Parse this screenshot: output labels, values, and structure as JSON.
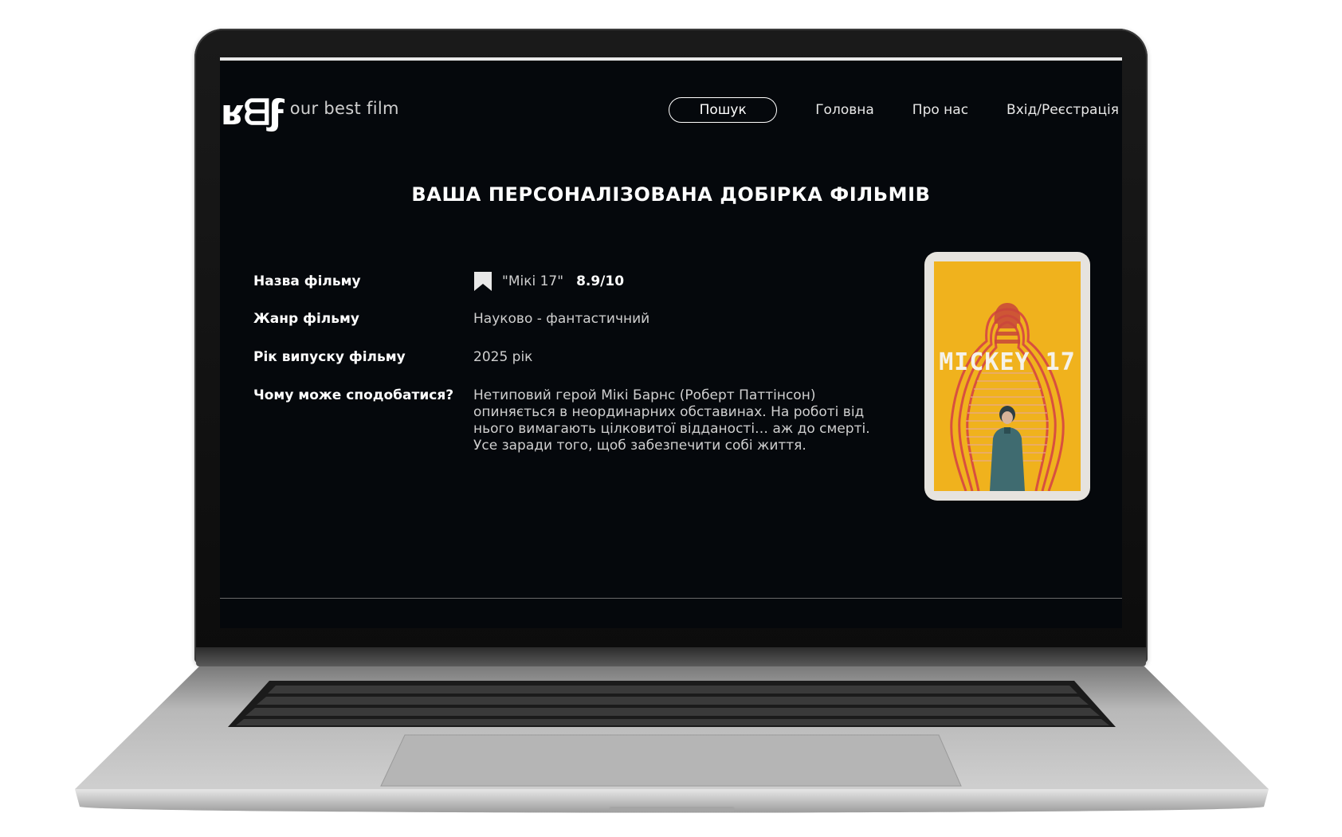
{
  "header": {
    "logo_mark": "ʁᗺϝ",
    "logo_tagline": "our best film",
    "nav": {
      "search_label": "Пошук",
      "home_label": "Головна",
      "about_label": "Про нас",
      "login_label": "Вхід/Реєстрація"
    }
  },
  "main": {
    "title": "ВАША ПЕРСОНАЛІЗОВАНА ДОБІРКА ФІЛЬМІВ",
    "details": {
      "title_label": "Назва фільму",
      "movie_name": "\"Мікі 17\"",
      "rating": "8.9/10",
      "genre_label": "Жанр фільму",
      "genre_value": "Науково - фантастичний",
      "year_label": "Рік випуску фільму",
      "year_value": "2025 рік",
      "why_label": "Чому може сподобатися?",
      "why_value": "Нетиповий герой Мікі Барнс (Роберт Паттінсон) опиняється в неординарних обставинах. На роботі від нього вимагають цілковитої відданості… аж до смерті. Усе заради того, щоб забезпечити собі життя."
    },
    "poster": {
      "title_text": "MICKEY 17",
      "background_color": "#f0b21d",
      "figure_color": "#d85a4a"
    }
  },
  "colors": {
    "screen_bg": "#05080c",
    "text_primary": "#ffffff",
    "text_secondary": "#cfcfcf"
  }
}
